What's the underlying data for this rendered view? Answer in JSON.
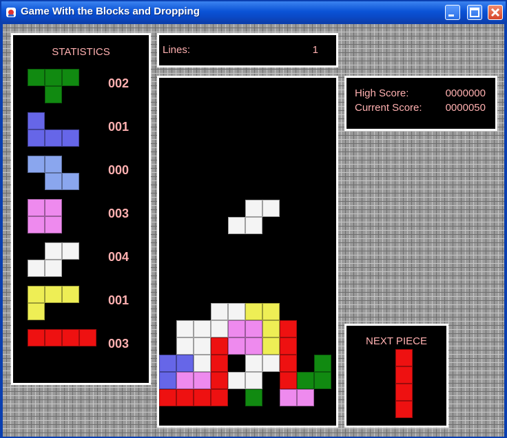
{
  "window": {
    "title": "Game With the Blocks and Dropping"
  },
  "colors": {
    "G": "#118a11",
    "B": "#6666e8",
    "L": "#8aa6ee",
    "P": "#ee8aee",
    "W": "#f4f4f4",
    "Y": "#eeee55",
    "R": "#ee1111"
  },
  "statistics": {
    "title": "STATISTICS",
    "pieces": [
      {
        "color": "G",
        "cells": [
          [
            0,
            0
          ],
          [
            1,
            0
          ],
          [
            2,
            0
          ],
          [
            1,
            1
          ]
        ],
        "count": "002"
      },
      {
        "color": "B",
        "cells": [
          [
            0,
            0
          ],
          [
            0,
            1
          ],
          [
            1,
            1
          ],
          [
            2,
            1
          ]
        ],
        "count": "001"
      },
      {
        "color": "L",
        "cells": [
          [
            0,
            0
          ],
          [
            1,
            0
          ],
          [
            1,
            1
          ],
          [
            2,
            1
          ]
        ],
        "count": "000"
      },
      {
        "color": "P",
        "cells": [
          [
            0,
            0
          ],
          [
            1,
            0
          ],
          [
            0,
            1
          ],
          [
            1,
            1
          ]
        ],
        "count": "003"
      },
      {
        "color": "W",
        "cells": [
          [
            1,
            0
          ],
          [
            2,
            0
          ],
          [
            0,
            1
          ],
          [
            1,
            1
          ]
        ],
        "count": "004"
      },
      {
        "color": "Y",
        "cells": [
          [
            0,
            0
          ],
          [
            1,
            0
          ],
          [
            2,
            0
          ],
          [
            0,
            1
          ]
        ],
        "count": "001"
      },
      {
        "color": "R",
        "cells": [
          [
            0,
            0
          ],
          [
            1,
            0
          ],
          [
            2,
            0
          ],
          [
            3,
            0
          ]
        ],
        "count": "003"
      }
    ]
  },
  "lines": {
    "label": "Lines:",
    "value": "1"
  },
  "scores": {
    "high_label": "High Score:",
    "high_value": "0000000",
    "current_label": "Current Score:",
    "current_value": "0000050"
  },
  "next_piece": {
    "title": "NEXT  PIECE",
    "color": "R",
    "cells": [
      [
        0,
        0
      ],
      [
        0,
        1
      ],
      [
        0,
        2
      ],
      [
        0,
        3
      ]
    ]
  },
  "board": {
    "falling_piece": {
      "color": "W",
      "cells": [
        [
          5,
          7
        ],
        [
          6,
          7
        ],
        [
          4,
          8
        ],
        [
          5,
          8
        ]
      ]
    },
    "rows": [
      "..........",
      "..........",
      "..........",
      "..........",
      "..........",
      "..........",
      "..........",
      "..........",
      "..........",
      "..........",
      "..........",
      "..........",
      "..........",
      "...WWYY...",
      ".WWWPPYR..",
      ".WWRPPYR..",
      "BBWR.WWR.G",
      "BPPRWW.RGG",
      "RRRR.G.PP."
    ]
  }
}
